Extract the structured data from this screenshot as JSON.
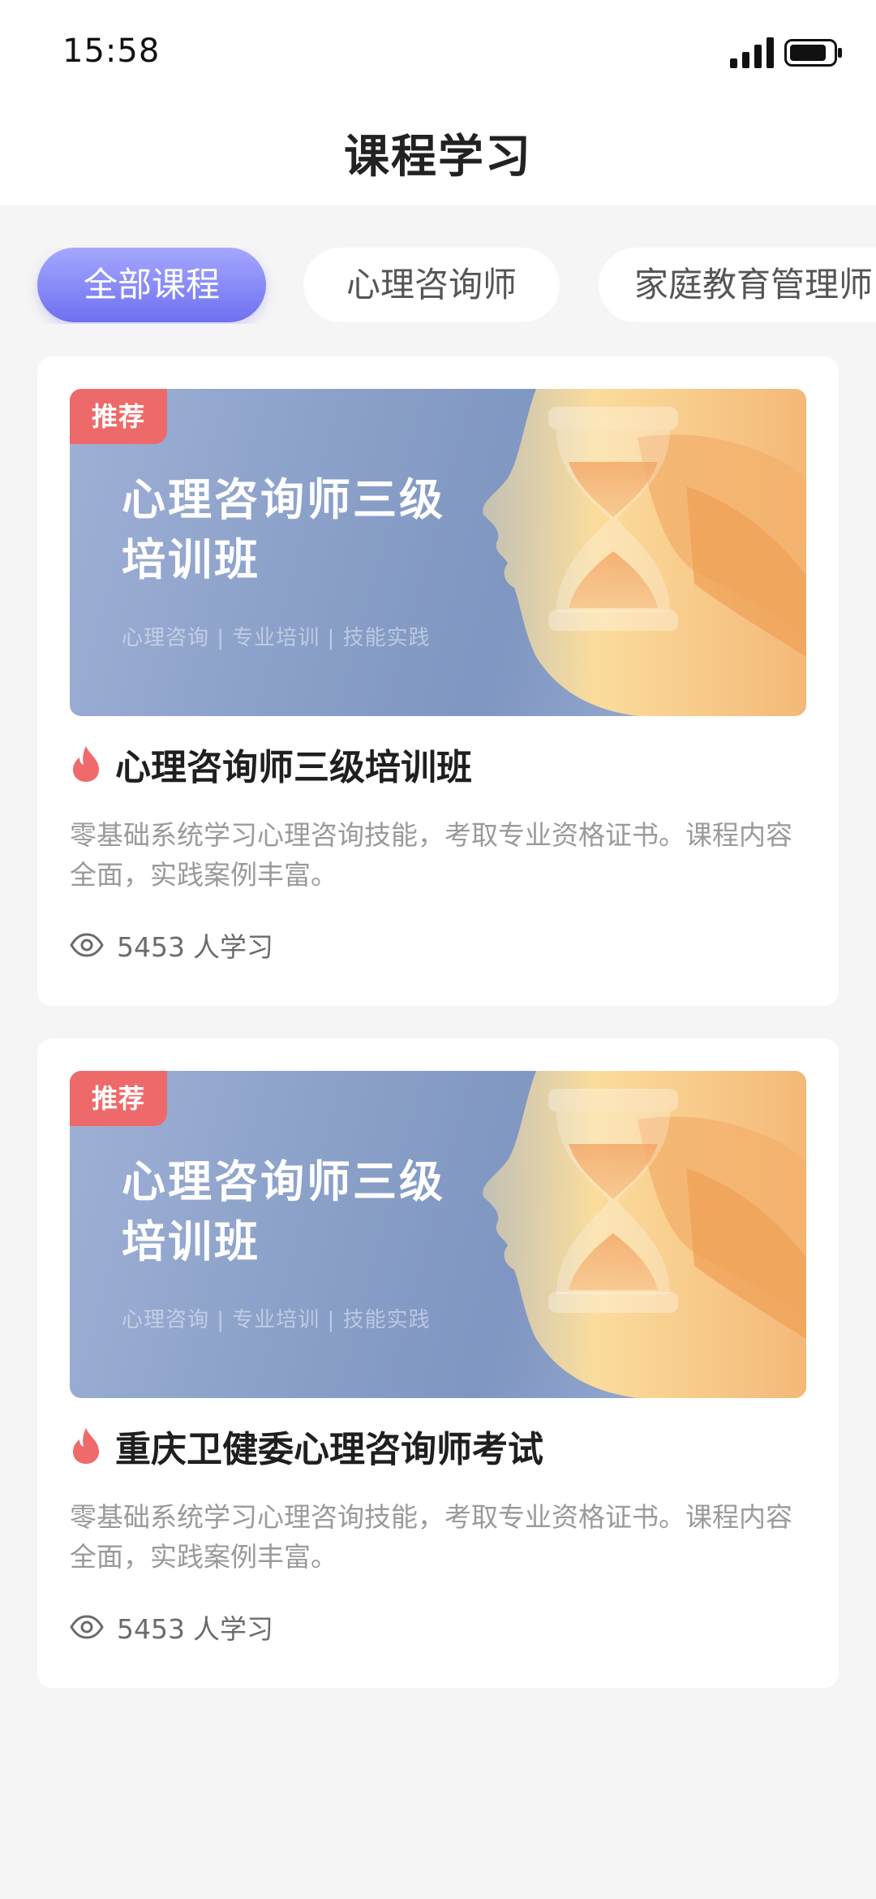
{
  "status_bar": {
    "time": "15:58"
  },
  "header": {
    "title": "课程学习"
  },
  "tabs": [
    {
      "label": "全部课程",
      "active": true
    },
    {
      "label": "心理咨询师",
      "active": false
    },
    {
      "label": "家庭教育管理师",
      "active": false
    }
  ],
  "courses": [
    {
      "badge": "推荐",
      "banner_title_line1": "心理咨询师三级",
      "banner_title_line2": "培训班",
      "banner_tags": "心理咨询  |   专业培训   |   技能实践",
      "title": "心理咨询师三级培训班",
      "description": "零基础系统学习心理咨询技能，考取专业资格证书。课程内容全面，实践案例丰富。",
      "learners": "5453",
      "learners_suffix": "人学习"
    },
    {
      "badge": "推荐",
      "banner_title_line1": "心理咨询师三级",
      "banner_title_line2": "培训班",
      "banner_tags": "心理咨询  |   专业培训   |   技能实践",
      "title": "重庆卫健委心理咨询师考试",
      "description": "零基础系统学习心理咨询技能，考取专业资格证书。课程内容全面，实践案例丰富。",
      "learners": "5453",
      "learners_suffix": "人学习"
    }
  ],
  "colors": {
    "accent": "#6e70f0",
    "badge": "#ee6a6a",
    "fire": "#ef6b6b"
  }
}
